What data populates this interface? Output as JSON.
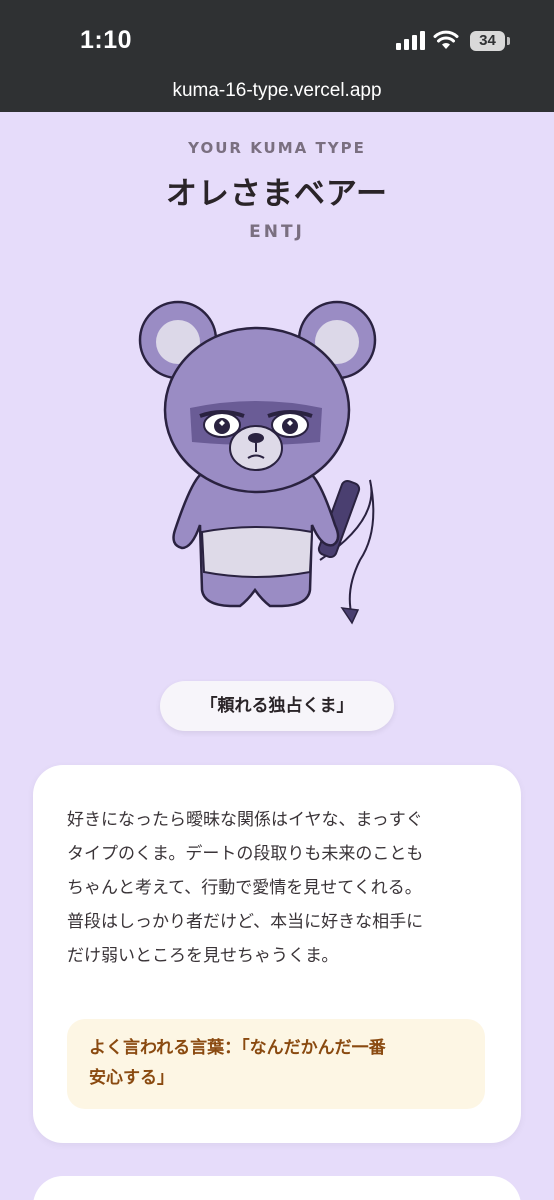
{
  "status_bar": {
    "time": "1:10",
    "battery": "34",
    "signal_icon": "cellular-signal-icon",
    "wifi_icon": "wifi-icon",
    "battery_icon": "battery-icon"
  },
  "browser": {
    "url": "kuma-16-type.vercel.app"
  },
  "result": {
    "kicker": "YOUR KUMA TYPE",
    "name": "オレさまベアー",
    "code": "ENTJ",
    "illustration": "bear-illustration",
    "tagline": "「頼れる独占くま」"
  },
  "description": {
    "lines": [
      "好きになったら曖昧な関係はイヤな、まっすぐ",
      "タイプのくま。デートの段取りも未来のことも",
      "ちゃんと考えて、行動で愛情を見せてくれる。",
      "普段はしっかり者だけど、本当に好きな相手に",
      "だけ弱いところを見せちゃうくま。"
    ],
    "quote_lines": [
      "よく言われる言葉：「なんだかんだ一番",
      "安心する」"
    ]
  },
  "colors": {
    "page_background": "#e6dcfa",
    "status_bar": "#2f3133",
    "bear_fur": "#9a8cc4",
    "quote_background": "#fdf6e4",
    "quote_text": "#8a4a10"
  }
}
